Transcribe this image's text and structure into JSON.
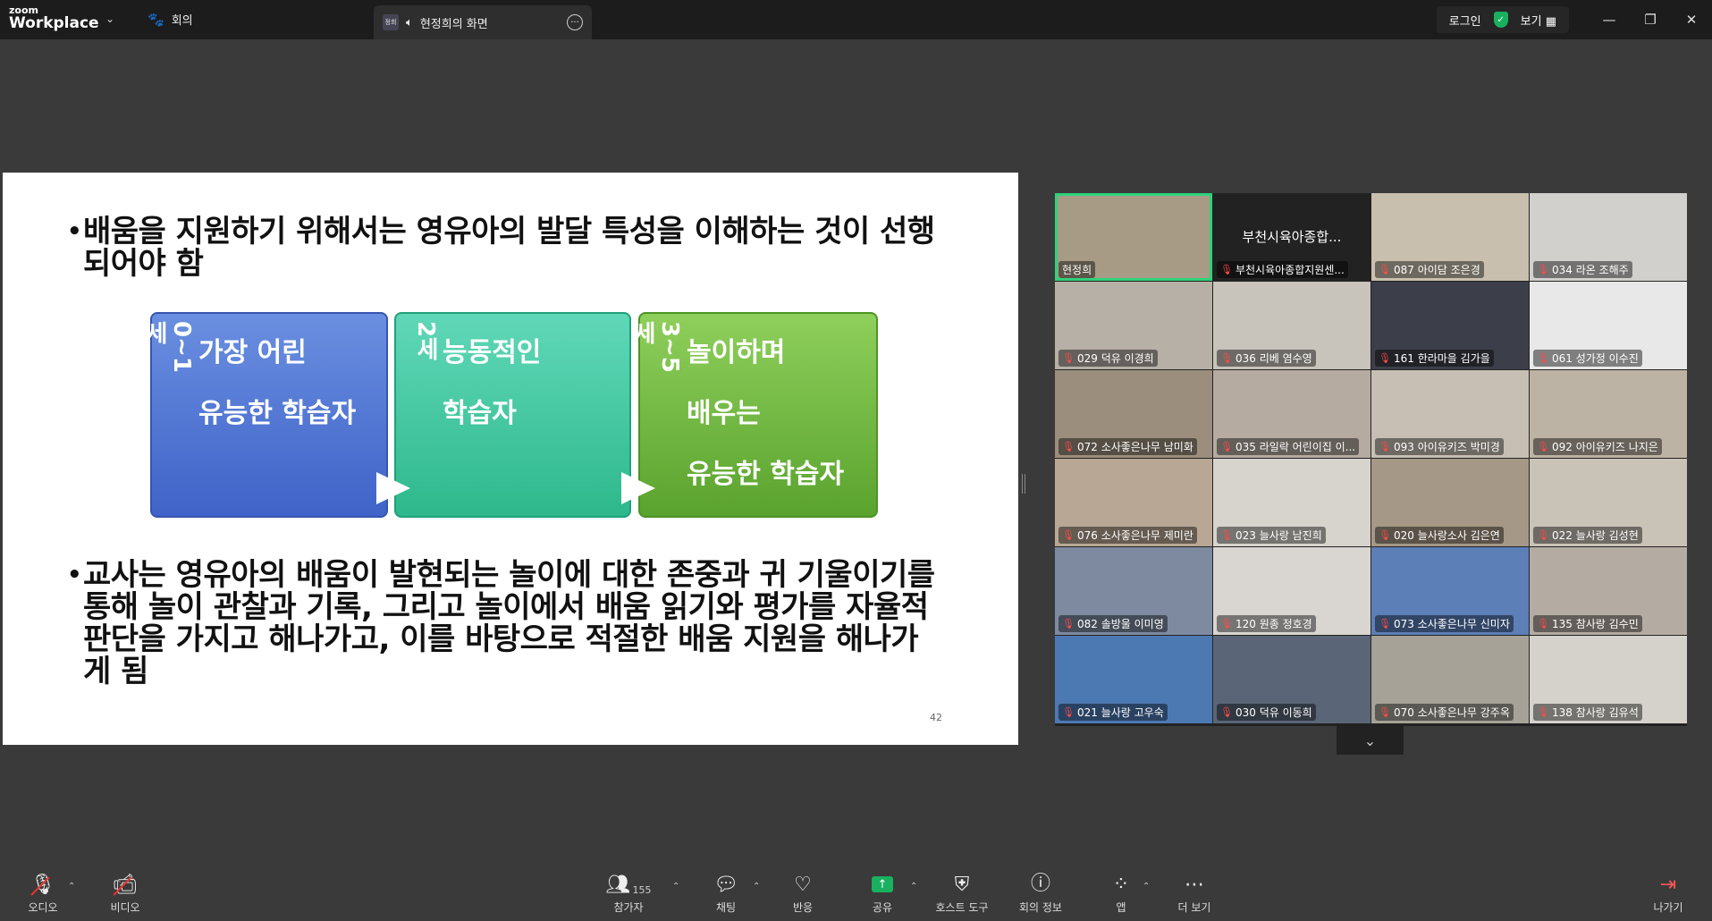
{
  "titlebar": {
    "brand_small": "zoom",
    "brand_big": "Workplace",
    "meeting_tab": "회의",
    "share_tab_avatar": "정희",
    "share_tab_title": "현정희의 화면",
    "login": "로그인",
    "view": "보기"
  },
  "slide": {
    "bullet1": "배움을 지원하기 위해서는 영유아의 발달 특성을 이해하는 것이 선행되어야 함",
    "bullet2": "교사는 영유아의 배움이 발현되는 놀이에 대한 존중과 귀 기울이기를 통해 놀이 관찰과 기록, 그리고 놀이에서 배움 읽기와 평가를 자율적 판단을 가지고 해나가고, 이를 바탕으로 적절한 배움 지원을 해나가게 됨",
    "page_number": "42",
    "boxes": [
      {
        "age": "0~1세",
        "line1": "가장 어린",
        "line2": "유능한 학습자",
        "line3": ""
      },
      {
        "age": "2세",
        "line1": "능동적인",
        "line2": "학습자",
        "line3": ""
      },
      {
        "age": "3~5세",
        "line1": "놀이하며",
        "line2": "배우는",
        "line3": "유능한 학습자"
      }
    ]
  },
  "participants": [
    {
      "name": "현정희",
      "muted": false,
      "bg": "#a89b86",
      "active": true
    },
    {
      "name": "부천시육아종합지원센...",
      "muted": true,
      "bg": "#222222",
      "label": "부천시육아종합..."
    },
    {
      "name": "087 아이담 조은경",
      "muted": true,
      "bg": "#c9bfae"
    },
    {
      "name": "034 라온 조해주",
      "muted": true,
      "bg": "#d2d0cc"
    },
    {
      "name": "029 덕유 이경희",
      "muted": true,
      "bg": "#b7b0a6"
    },
    {
      "name": "036 리베 염수영",
      "muted": true,
      "bg": "#c8c3bb"
    },
    {
      "name": "161 한라마을 김가을",
      "muted": true,
      "bg": "#3c3f4a"
    },
    {
      "name": "061 성가정 이수진",
      "muted": true,
      "bg": "#e8e8e8"
    },
    {
      "name": "072 소사좋은나무 남미화",
      "muted": true,
      "bg": "#9c8e7c"
    },
    {
      "name": "035 라일락 어린이집 이...",
      "muted": true,
      "bg": "#b5aba0"
    },
    {
      "name": "093 아이유키즈 박미경",
      "muted": true,
      "bg": "#c7bfb4"
    },
    {
      "name": "092 아이유키즈 나지은",
      "muted": true,
      "bg": "#bdb3a4"
    },
    {
      "name": "076 소사좋은나무 제미란",
      "muted": true,
      "bg": "#b8a794"
    },
    {
      "name": "023 늘사랑 남진희",
      "muted": true,
      "bg": "#d7d3cd"
    },
    {
      "name": "020 늘사랑소사 김은연",
      "muted": true,
      "bg": "#a69886"
    },
    {
      "name": "022 늘사랑 김성현",
      "muted": true,
      "bg": "#c9c2b6"
    },
    {
      "name": "082 솔방울 이미영",
      "muted": true,
      "bg": "#7d8aa0"
    },
    {
      "name": "120 원종 정호경",
      "muted": true,
      "bg": "#d9d6d1"
    },
    {
      "name": "073 소사좋은나무 신미자",
      "muted": true,
      "bg": "#5c7fb8"
    },
    {
      "name": "135 참사랑 김수민",
      "muted": true,
      "bg": "#b4aca2"
    },
    {
      "name": "021 늘사랑 고우숙",
      "muted": true,
      "bg": "#4d79b3"
    },
    {
      "name": "030 덕유 이동희",
      "muted": true,
      "bg": "#5a6677"
    },
    {
      "name": "070 소사좋은나무 강주옥",
      "muted": true,
      "bg": "#a7a297"
    },
    {
      "name": "138 참사랑 김유석",
      "muted": true,
      "bg": "#d5d2cc"
    }
  ],
  "toolbar": {
    "audio": "오디오",
    "video": "비디오",
    "participants": "참가자",
    "participants_count": "155",
    "chat": "채팅",
    "reactions": "반응",
    "share": "공유",
    "host_tools": "호스트 도구",
    "meeting_info": "회의 정보",
    "apps": "앱",
    "more": "더 보기",
    "leave": "나가기"
  }
}
